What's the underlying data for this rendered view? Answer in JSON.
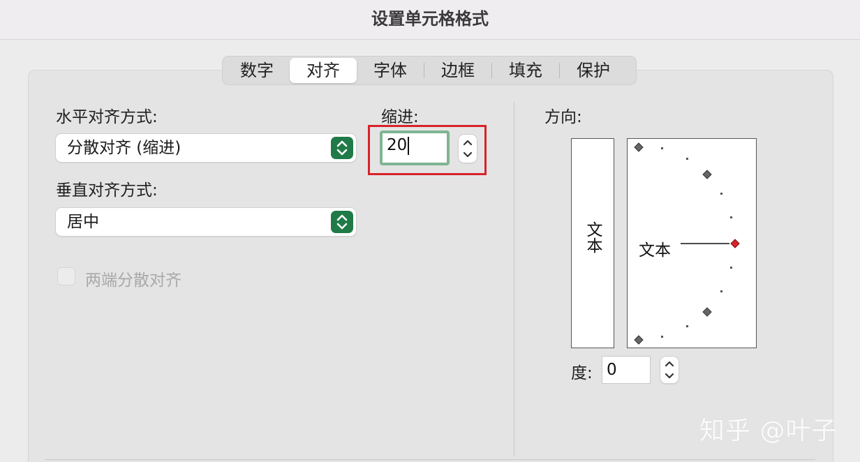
{
  "window": {
    "title": "设置单元格格式"
  },
  "tabs": [
    {
      "label": "数字",
      "selected": false
    },
    {
      "label": "对齐",
      "selected": true
    },
    {
      "label": "字体",
      "selected": false
    },
    {
      "label": "边框",
      "selected": false
    },
    {
      "label": "填充",
      "selected": false
    },
    {
      "label": "保护",
      "selected": false
    }
  ],
  "alignment": {
    "horizontal_label": "水平对齐方式:",
    "horizontal_value": "分散对齐 (缩进)",
    "vertical_label": "垂直对齐方式:",
    "vertical_value": "居中",
    "justify_distributed_label": "两端分散对齐",
    "justify_distributed_checked": false,
    "indent_label": "缩进:",
    "indent_value": "20"
  },
  "orientation": {
    "label": "方向:",
    "vertical_text": "文本",
    "dial_text": "文本",
    "degree_label": "度:",
    "degree_value": "0"
  },
  "colors": {
    "accent_green": "#1f7a48",
    "focus_ring": "#7fb592",
    "highlight_red": "#d8232a",
    "dial_active": "#d8232a"
  },
  "watermark": "知乎 @叶子"
}
